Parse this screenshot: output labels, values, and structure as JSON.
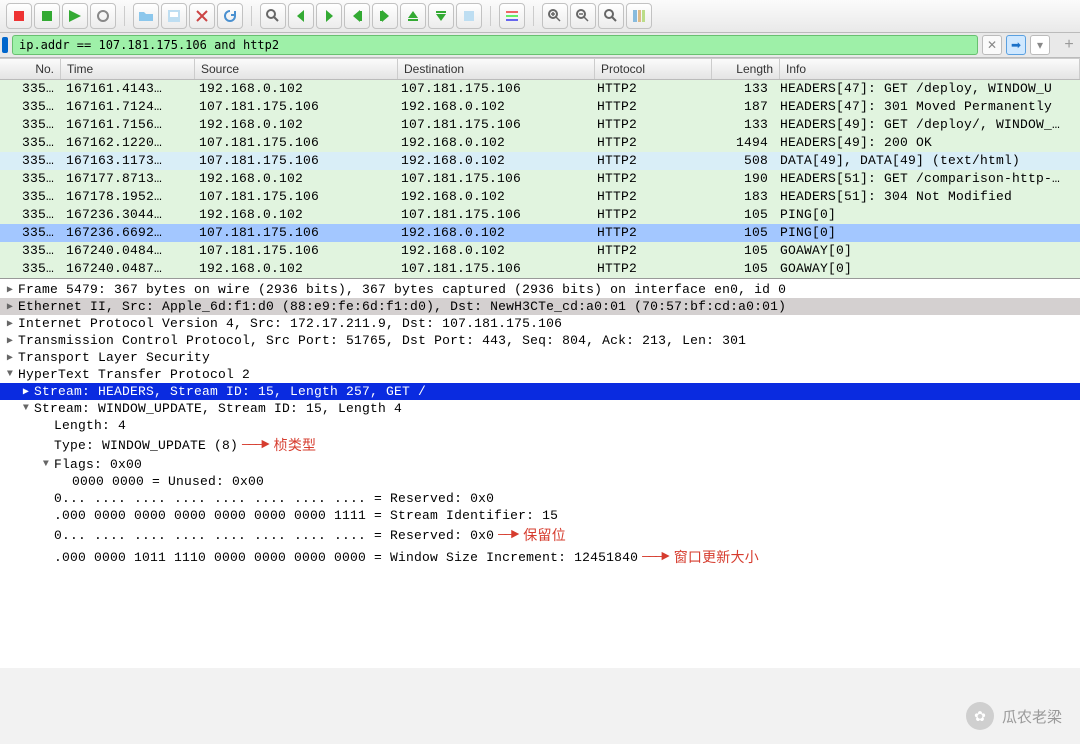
{
  "filter": {
    "value": "ip.addr == 107.181.175.106 and http2"
  },
  "columns": {
    "no": "No.",
    "time": "Time",
    "src": "Source",
    "dst": "Destination",
    "proto": "Protocol",
    "len": "Length",
    "info": "Info"
  },
  "packets": [
    {
      "no": "335…",
      "time": "167161.4143…",
      "src": "192.168.0.102",
      "dst": "107.181.175.106",
      "proto": "HTTP2",
      "len": "133",
      "info": "HEADERS[47]: GET /deploy, WINDOW_U",
      "cls": "bg-he"
    },
    {
      "no": "335…",
      "time": "167161.7124…",
      "src": "107.181.175.106",
      "dst": "192.168.0.102",
      "proto": "HTTP2",
      "len": "187",
      "info": "HEADERS[47]: 301 Moved Permanently",
      "cls": "bg-he"
    },
    {
      "no": "335…",
      "time": "167161.7156…",
      "src": "192.168.0.102",
      "dst": "107.181.175.106",
      "proto": "HTTP2",
      "len": "133",
      "info": "HEADERS[49]: GET /deploy/, WINDOW_…",
      "cls": "bg-he"
    },
    {
      "no": "335…",
      "time": "167162.1220…",
      "src": "107.181.175.106",
      "dst": "192.168.0.102",
      "proto": "HTTP2",
      "len": "1494",
      "info": "HEADERS[49]: 200 OK",
      "cls": "bg-he"
    },
    {
      "no": "335…",
      "time": "167163.1173…",
      "src": "107.181.175.106",
      "dst": "192.168.0.102",
      "proto": "HTTP2",
      "len": "508",
      "info": "DATA[49], DATA[49] (text/html)",
      "cls": "bg-pl"
    },
    {
      "no": "335…",
      "time": "167177.8713…",
      "src": "192.168.0.102",
      "dst": "107.181.175.106",
      "proto": "HTTP2",
      "len": "190",
      "info": "HEADERS[51]: GET /comparison-http-…",
      "cls": "bg-he"
    },
    {
      "no": "335…",
      "time": "167178.1952…",
      "src": "107.181.175.106",
      "dst": "192.168.0.102",
      "proto": "HTTP2",
      "len": "183",
      "info": "HEADERS[51]: 304 Not Modified",
      "cls": "bg-he"
    },
    {
      "no": "335…",
      "time": "167236.3044…",
      "src": "192.168.0.102",
      "dst": "107.181.175.106",
      "proto": "HTTP2",
      "len": "105",
      "info": "PING[0]",
      "cls": "bg-he"
    },
    {
      "no": "335…",
      "time": "167236.6692…",
      "src": "107.181.175.106",
      "dst": "192.168.0.102",
      "proto": "HTTP2",
      "len": "105",
      "info": "PING[0]",
      "cls": "row-sel"
    },
    {
      "no": "335…",
      "time": "167240.0484…",
      "src": "107.181.175.106",
      "dst": "192.168.0.102",
      "proto": "HTTP2",
      "len": "105",
      "info": "GOAWAY[0]",
      "cls": "bg-he"
    },
    {
      "no": "335…",
      "time": "167240.0487…",
      "src": "192.168.0.102",
      "dst": "107.181.175.106",
      "proto": "HTTP2",
      "len": "105",
      "info": "GOAWAY[0]",
      "cls": "bg-he"
    }
  ],
  "tree": {
    "frame": "Frame 5479: 367 bytes on wire (2936 bits), 367 bytes captured (2936 bits) on interface en0, id 0",
    "eth": "Ethernet II, Src: Apple_6d:f1:d0 (88:e9:fe:6d:f1:d0), Dst: NewH3CTe_cd:a0:01 (70:57:bf:cd:a0:01)",
    "ip": "Internet Protocol Version 4, Src: 172.17.211.9, Dst: 107.181.175.106",
    "tcp": "Transmission Control Protocol, Src Port: 51765, Dst Port: 443, Seq: 804, Ack: 213, Len: 301",
    "tls": "Transport Layer Security",
    "h2": "HyperText Transfer Protocol 2",
    "stream_headers": "Stream: HEADERS, Stream ID: 15, Length 257, GET /",
    "stream_wu": "Stream: WINDOW_UPDATE, Stream ID: 15, Length 4",
    "length": "Length: 4",
    "type": "Type: WINDOW_UPDATE (8)",
    "flags": "Flags: 0x00",
    "flags_unused": "0000 0000 = Unused: 0x00",
    "reserved1": "0... .... .... .... .... .... .... .... = Reserved: 0x0",
    "stream_id": ".000 0000 0000 0000 0000 0000 0000 1111 = Stream Identifier: 15",
    "reserved2": "0... .... .... .... .... .... .... .... = Reserved: 0x0",
    "winsize": ".000 0000 1011 1110 0000 0000 0000 0000 = Window Size Increment: 12451840"
  },
  "annotations": {
    "type": "桢类型",
    "reserved": "保留位",
    "winsize": "窗口更新大小"
  },
  "watermark": "瓜农老梁",
  "toolbarIcons": [
    "start",
    "stop",
    "restart",
    "options",
    "open",
    "save",
    "close",
    "reload",
    "find",
    "prev",
    "next",
    "jump-prev",
    "jump-next",
    "top",
    "bottom",
    "autoscroll",
    "colorize",
    "zoom-in",
    "zoom-out",
    "zoom-reset",
    "resize-columns"
  ]
}
